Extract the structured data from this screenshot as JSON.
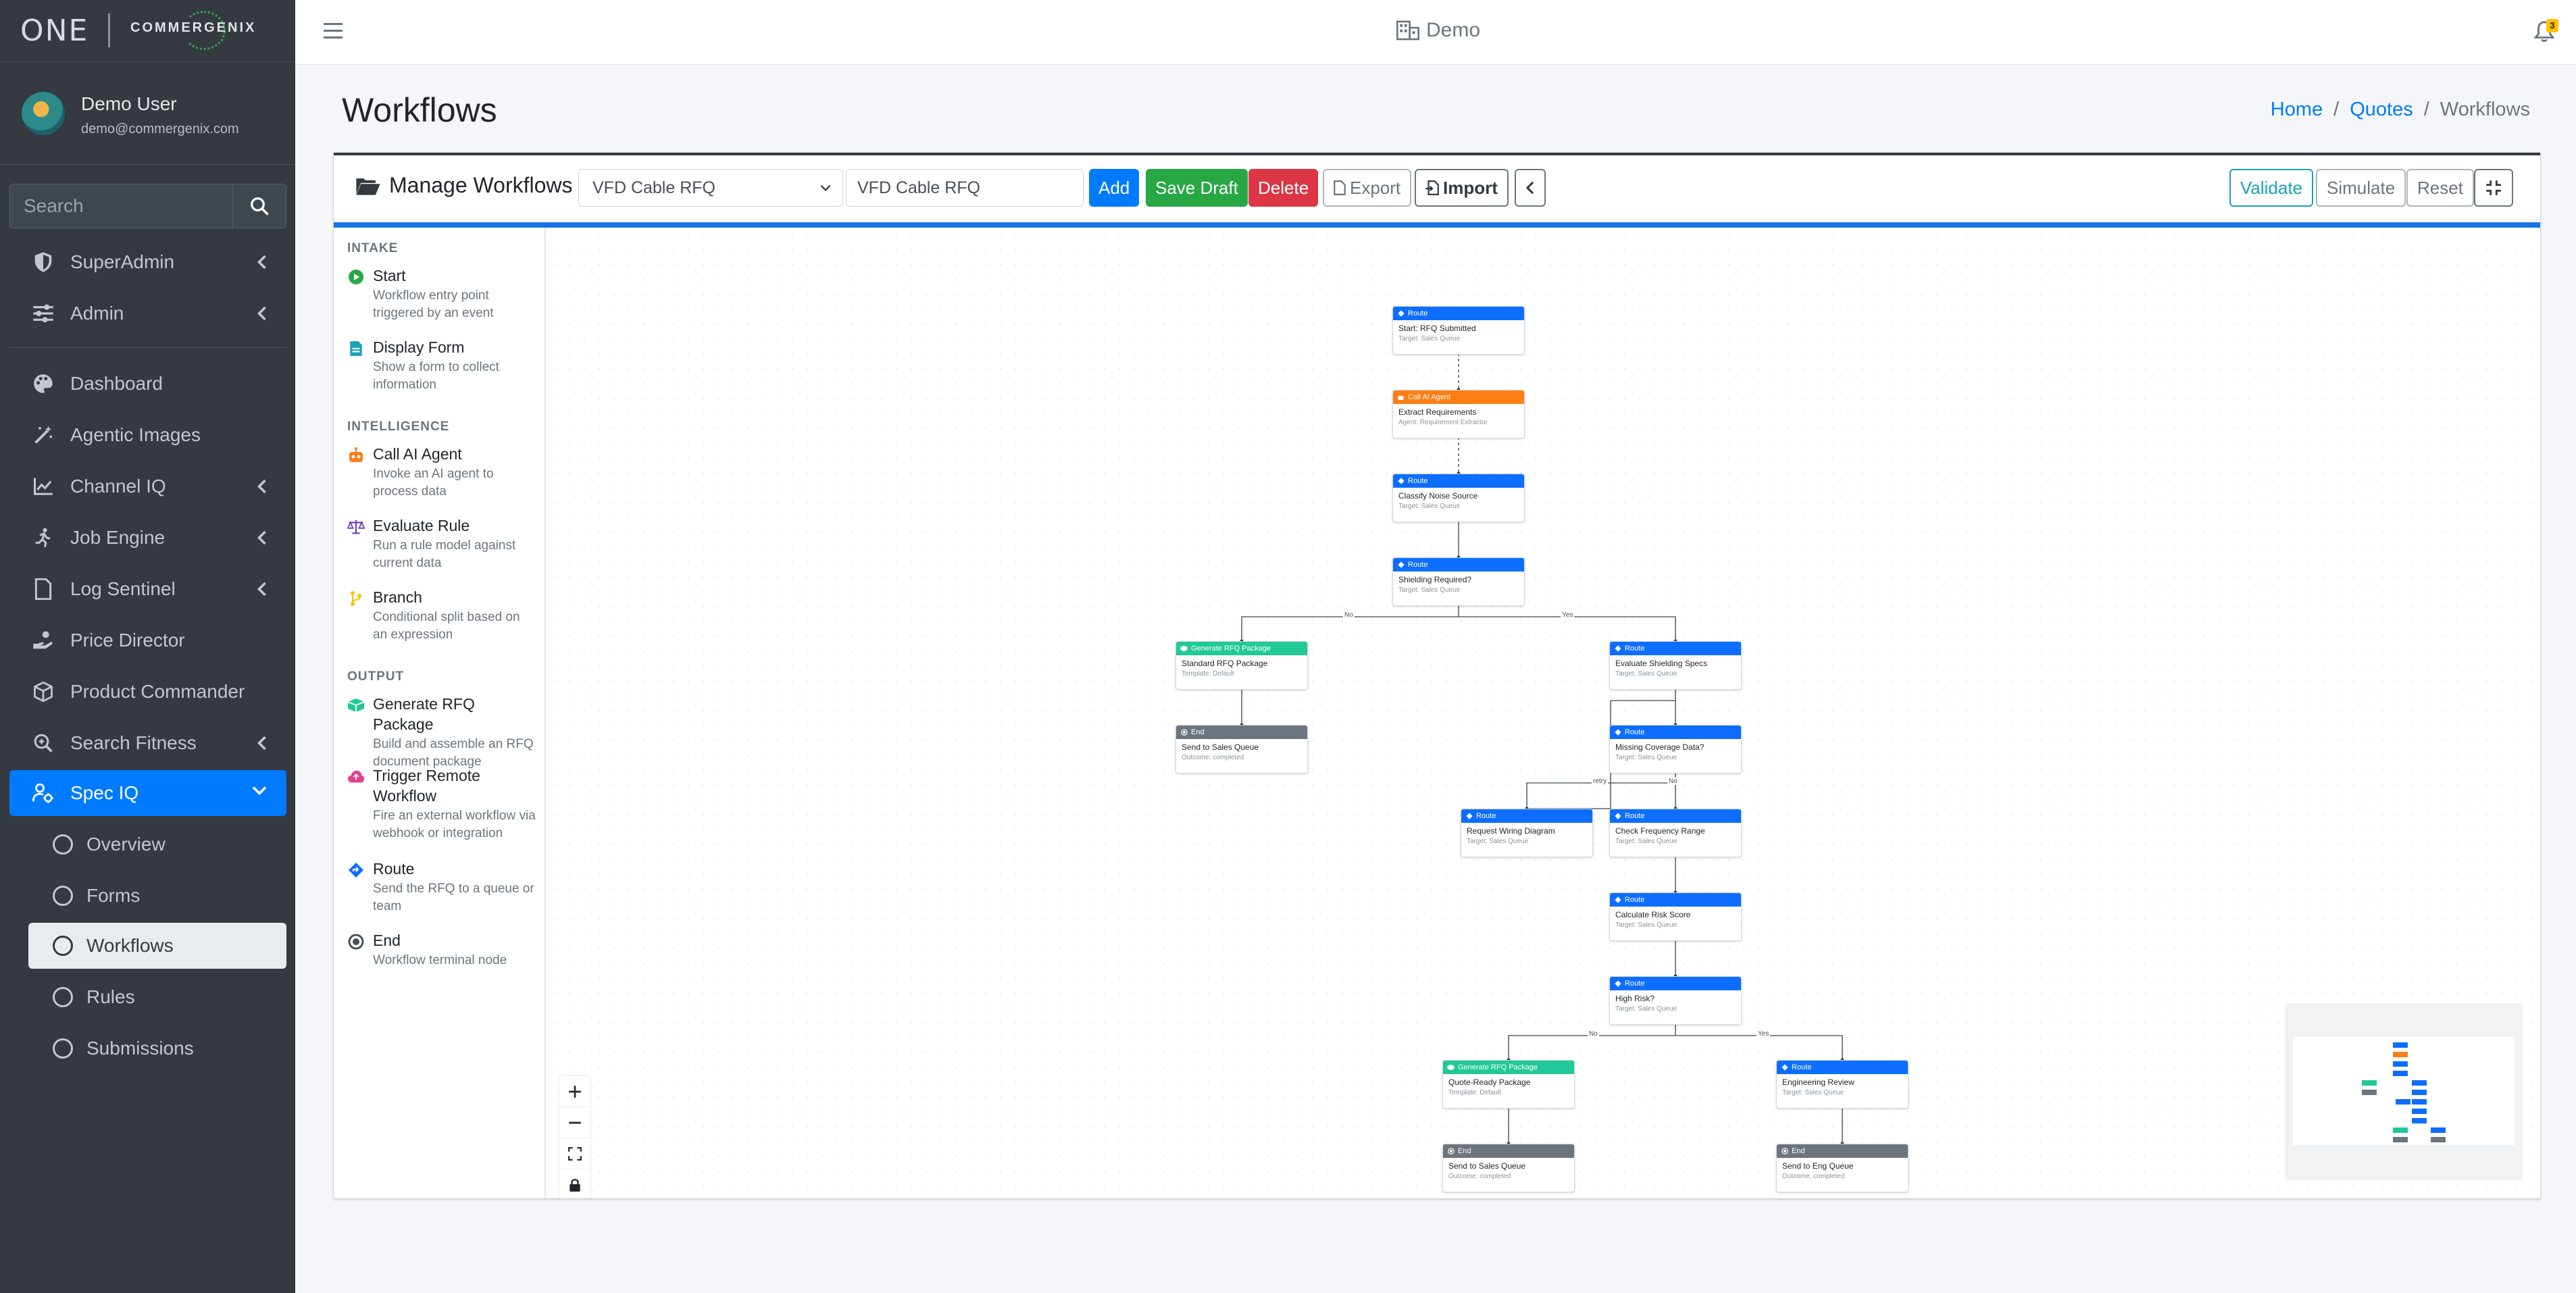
{
  "brand": {
    "logo_one": "ONE",
    "logo_commergenix": "COMMERGENIX"
  },
  "user": {
    "name": "Demo User",
    "email": "demo@commergenix.com"
  },
  "sidebar": {
    "search_placeholder": "Search",
    "items": [
      {
        "label": "SuperAdmin",
        "icon": "shield-icon",
        "chevron": true
      },
      {
        "label": "Admin",
        "icon": "sliders-icon",
        "chevron": true
      },
      {
        "label": "Dashboard",
        "icon": "palette-icon",
        "chevron": false
      },
      {
        "label": "Agentic Images",
        "icon": "magic-wand-icon",
        "chevron": false
      },
      {
        "label": "Channel IQ",
        "icon": "line-chart-icon",
        "chevron": true
      },
      {
        "label": "Job Engine",
        "icon": "running-icon",
        "chevron": true
      },
      {
        "label": "Log Sentinel",
        "icon": "file-icon",
        "chevron": true
      },
      {
        "label": "Price Director",
        "icon": "hand-coins-icon",
        "chevron": false
      },
      {
        "label": "Product Commander",
        "icon": "box-icon",
        "chevron": false
      },
      {
        "label": "Search Fitness",
        "icon": "search-plus-icon",
        "chevron": true
      },
      {
        "label": "Spec IQ",
        "icon": "user-cog-icon",
        "chevron": true,
        "active": true
      }
    ],
    "sub_items": [
      {
        "label": "Overview"
      },
      {
        "label": "Forms"
      },
      {
        "label": "Workflows",
        "active": true
      },
      {
        "label": "Rules"
      },
      {
        "label": "Submissions"
      }
    ]
  },
  "topbar": {
    "tenant": "Demo",
    "notification_count": "3"
  },
  "page": {
    "title": "Workflows",
    "breadcrumb": [
      "Home",
      "/",
      "Quotes",
      "/",
      "Workflows"
    ]
  },
  "toolbar": {
    "title": "Manage Workflows",
    "selected_workflow": "VFD Cable RFQ",
    "name_value": "VFD Cable RFQ",
    "add": "Add",
    "save_draft": "Save Draft",
    "delete": "Delete",
    "export": "Export",
    "import": "Import",
    "validate": "Validate",
    "simulate": "Simulate",
    "reset": "Reset"
  },
  "palette": {
    "sections": [
      {
        "title": "INTAKE",
        "items": [
          {
            "name": "Start",
            "desc": "Workflow entry point triggered by an event"
          },
          {
            "name": "Display Form",
            "desc": "Show a form to collect information"
          }
        ]
      },
      {
        "title": "INTELLIGENCE",
        "items": [
          {
            "name": "Call AI Agent",
            "desc": "Invoke an AI agent to process data"
          },
          {
            "name": "Evaluate Rule",
            "desc": "Run a rule model against current data"
          },
          {
            "name": "Branch",
            "desc": "Conditional split based on an expression"
          }
        ]
      },
      {
        "title": "OUTPUT",
        "items": [
          {
            "name": "Generate RFQ Package",
            "desc": "Build and assemble an RFQ document package"
          },
          {
            "name": "Trigger Remote Workflow",
            "desc": "Fire an external workflow via webhook or integration"
          },
          {
            "name": "Route",
            "desc": "Send the RFQ to a queue or team"
          },
          {
            "name": "End",
            "desc": "Workflow terminal node"
          }
        ]
      }
    ]
  },
  "nodes": [
    {
      "type": "Route",
      "title": "Start: RFQ Submitted",
      "sub": "Target: Sales Queue"
    },
    {
      "type": "Call AI Agent",
      "title": "Extract Requirements",
      "sub": "Agent: Requirement Extractor"
    },
    {
      "type": "Route",
      "title": "Classify Noise Source",
      "sub": "Target: Sales Queue"
    },
    {
      "type": "Route",
      "title": "Shielding Required?",
      "sub": "Target: Sales Queue"
    },
    {
      "type": "Generate RFQ Package",
      "title": "Standard RFQ Package",
      "sub": "Template: Default"
    },
    {
      "type": "Route",
      "title": "Evaluate Shielding Specs",
      "sub": "Target: Sales Queue"
    },
    {
      "type": "End",
      "title": "Send to Sales Queue",
      "sub": "Outcome: completed"
    },
    {
      "type": "Route",
      "title": "Missing Coverage Data?",
      "sub": "Target: Sales Queue"
    },
    {
      "type": "Route",
      "title": "Request Wiring Diagram",
      "sub": "Target: Sales Queue"
    },
    {
      "type": "Route",
      "title": "Check Frequency Range",
      "sub": "Target: Sales Queue"
    },
    {
      "type": "Route",
      "title": "Calculate Risk Score",
      "sub": "Target: Sales Queue"
    },
    {
      "type": "Route",
      "title": "High Risk?",
      "sub": "Target: Sales Queue"
    },
    {
      "type": "Generate RFQ Package",
      "title": "Quote-Ready Package",
      "sub": "Template: Default"
    },
    {
      "type": "Route",
      "title": "Engineering Review",
      "sub": "Target: Sales Queue"
    },
    {
      "type": "End",
      "title": "Send to Sales Queue",
      "sub": "Outcome: completed"
    },
    {
      "type": "End",
      "title": "Send to Eng Queue",
      "sub": "Outcome: completed"
    }
  ],
  "edge_labels": [
    "No",
    "Yes",
    "retry",
    "No",
    "No",
    "Yes"
  ],
  "colors": {
    "route": "#0d6efd",
    "agent": "#fd7e14",
    "generate": "#20c997",
    "end": "#6c757d",
    "sidebar_active": "#007bff"
  }
}
